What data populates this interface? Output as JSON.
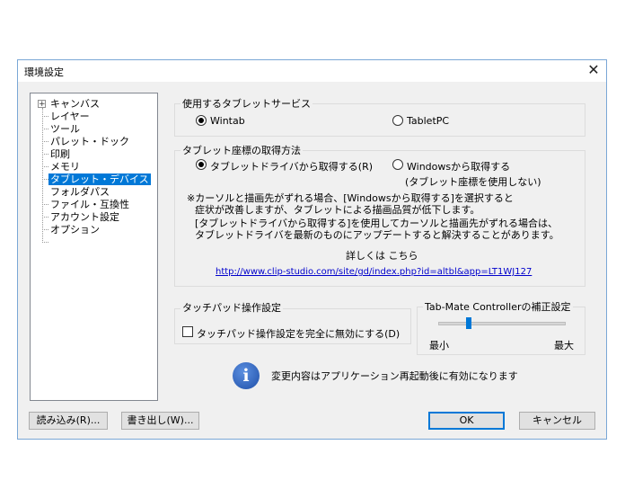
{
  "window": {
    "title": "環境設定",
    "close_glyph": "✕"
  },
  "tree": {
    "expander_glyph": "+",
    "items": [
      "キャンバス",
      "レイヤー",
      "ツール",
      "パレット・ドック",
      "印刷",
      "メモリ",
      "タブレット・デバイス",
      "フォルダパス",
      "ファイル・互換性",
      "アカウント設定",
      "オプション"
    ],
    "selected": "タブレット・デバイス"
  },
  "tablet_service": {
    "label": "使用するタブレットサービス",
    "options": [
      "Wintab",
      "TabletPC"
    ],
    "selected": "Wintab"
  },
  "coordinate": {
    "label": "タブレット座標の取得方法",
    "options": [
      "タブレットドライバから取得する(R)",
      "Windowsから取得する"
    ],
    "selected": "タブレットドライバから取得する(R)",
    "option2_note": "(タブレット座標を使用しない)",
    "note_lines": [
      "※カーソルと描画先がずれる場合、[Windowsから取得する]を選択すると",
      "症状が改善しますが、タブレットによる描画品質が低下します。",
      "[タブレットドライバから取得する]を使用してカーソルと描画先がずれる場合は、",
      "タブレットドライバを最新のものにアップデートすると解決することがあります。"
    ],
    "details_text": "詳しくは こちら",
    "url": "http://www.clip-studio.com/site/gd/index.php?id=altbl&app=LT1WJ127"
  },
  "touchpad": {
    "label": "タッチパッド操作設定",
    "checkbox_label": "タッチパッド操作設定を完全に無効にする(D)",
    "checked": false
  },
  "tabmate": {
    "label": "Tab-Mate Controllerの補正設定",
    "min_label": "最小",
    "max_label": "最大",
    "value_fraction": 0.24
  },
  "info": {
    "icon": "info-icon",
    "glyph": "i",
    "message": "変更内容はアプリケーション再起動後に有効になります"
  },
  "footer": {
    "import_label": "読み込み(R)...",
    "export_label": "書き出し(W)...",
    "ok_label": "OK",
    "cancel_label": "キャンセル"
  }
}
